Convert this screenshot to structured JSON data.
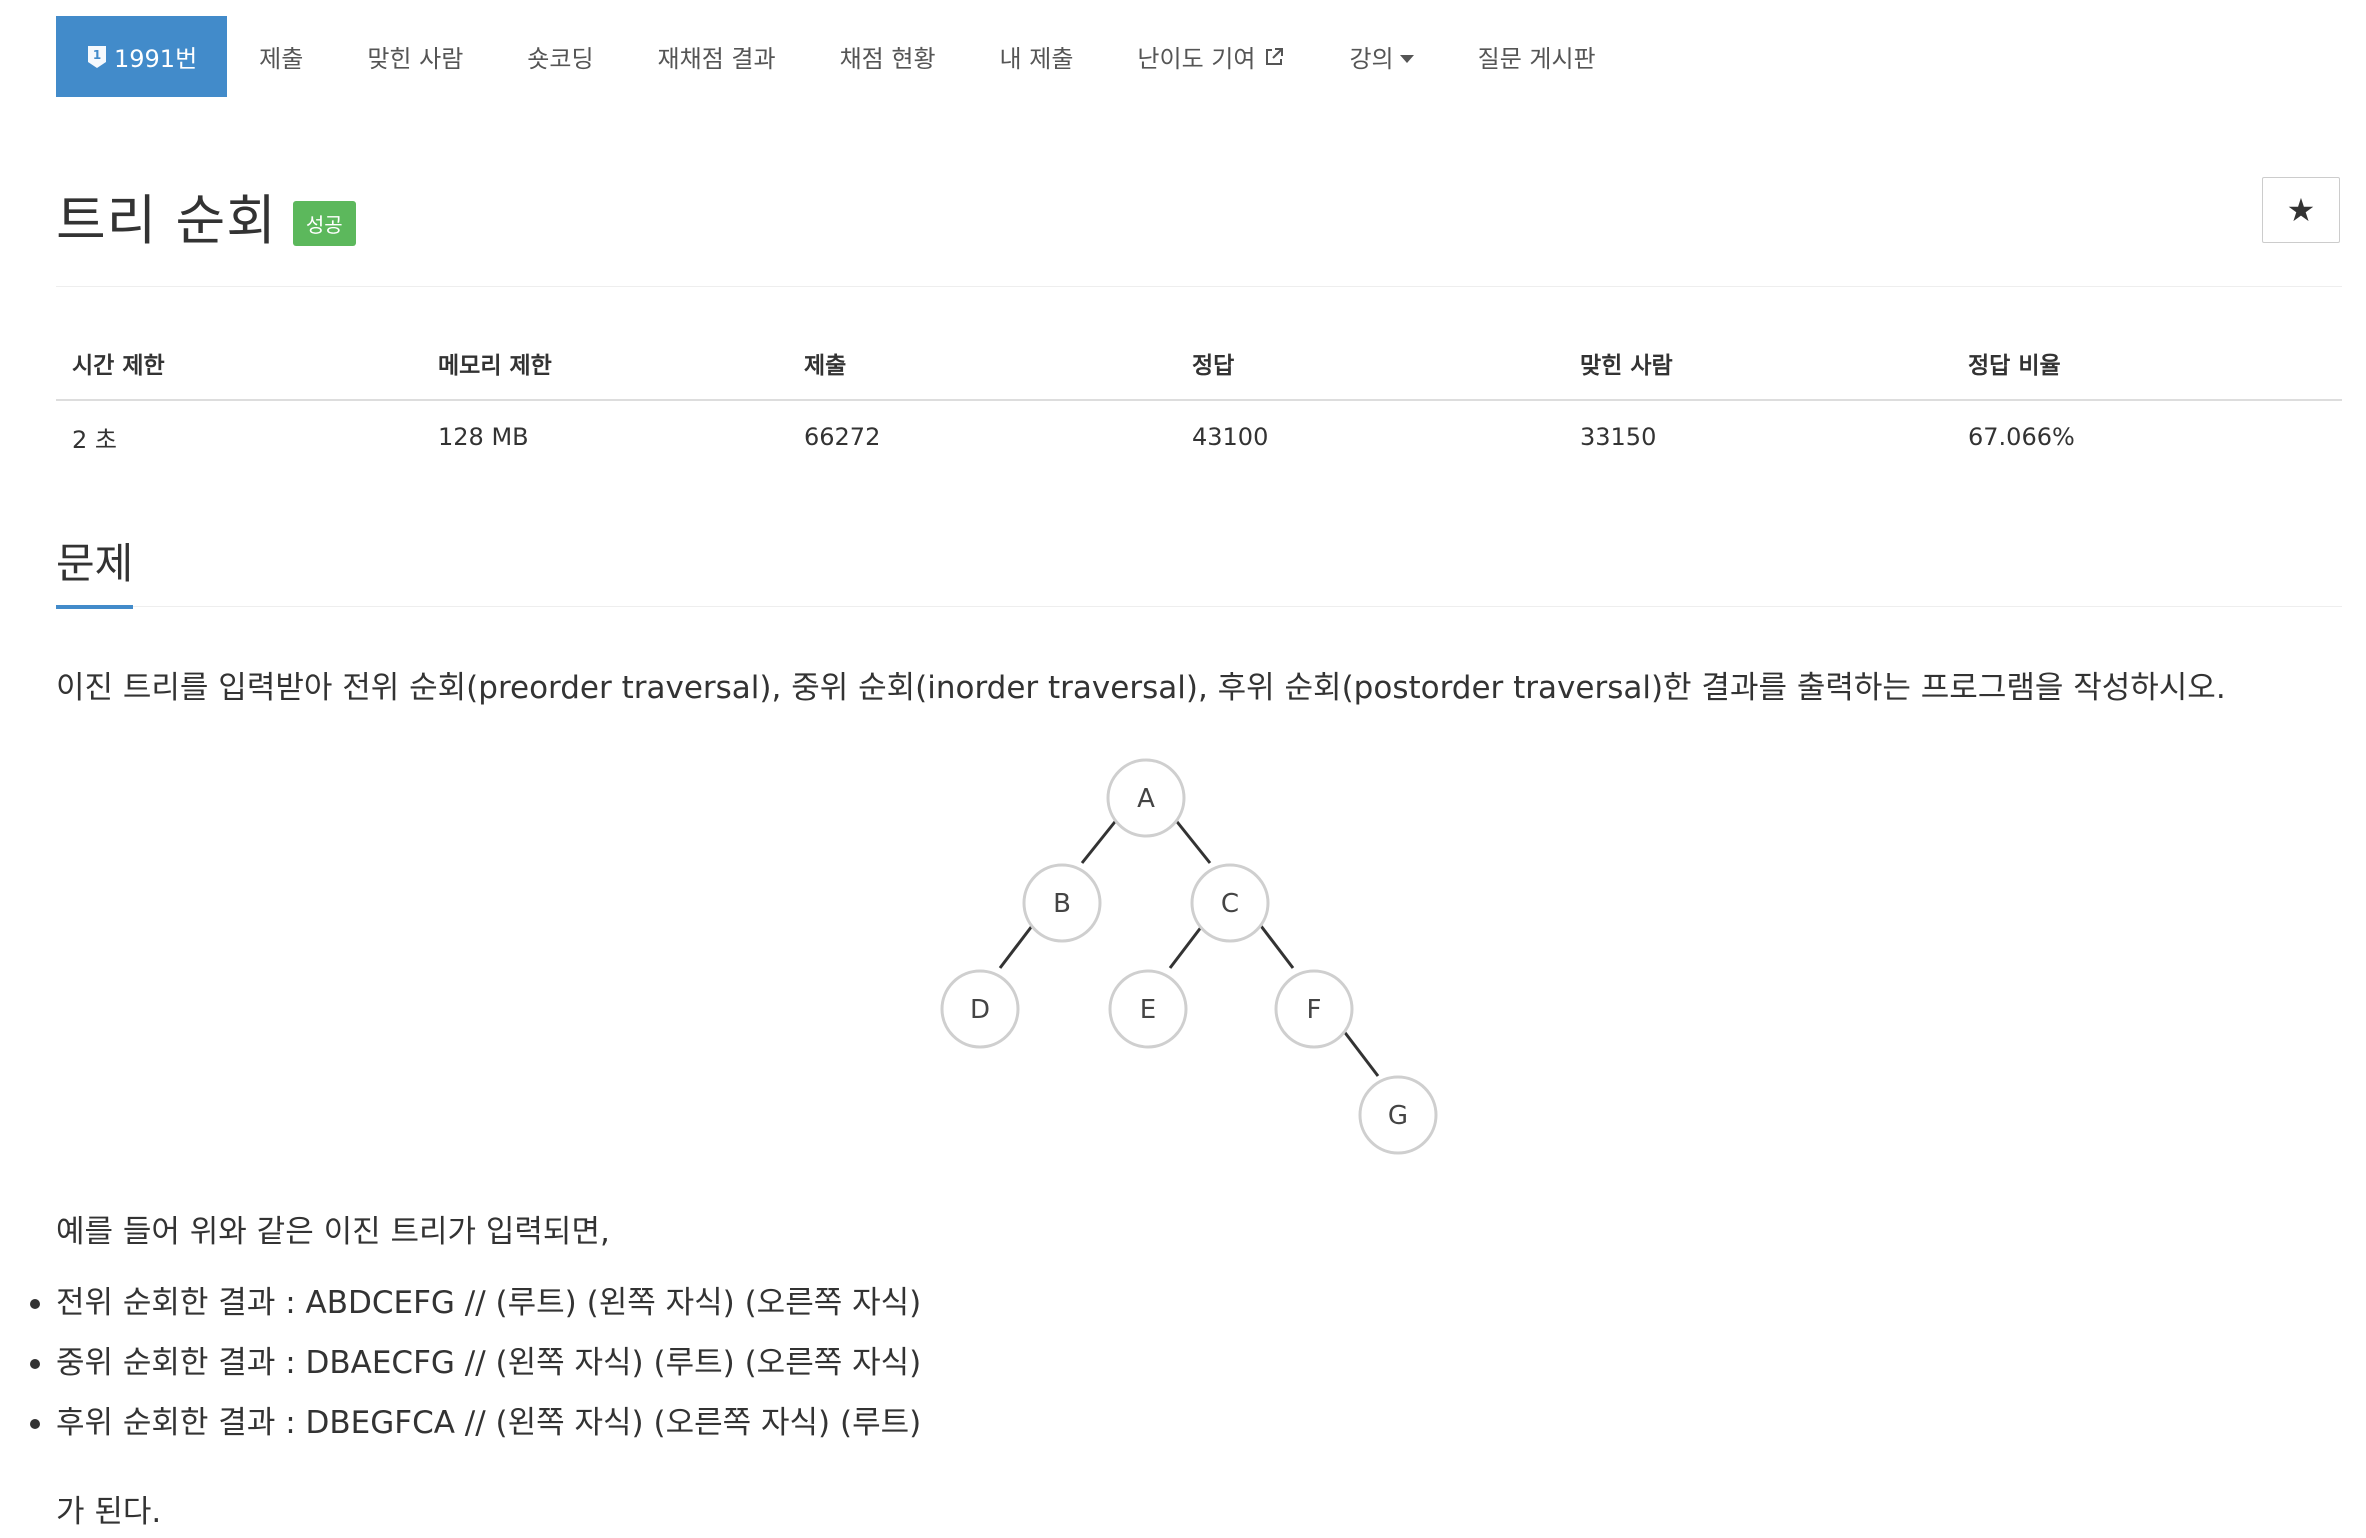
{
  "nav": {
    "problem_number": "1991번",
    "problem_badge_icon": "level-badge-icon",
    "items": [
      {
        "label": "제출"
      },
      {
        "label": "맞힌 사람"
      },
      {
        "label": "숏코딩"
      },
      {
        "label": "재채점 결과"
      },
      {
        "label": "채점 현황"
      },
      {
        "label": "내 제출"
      },
      {
        "label": "난이도 기여",
        "icon": "external-link-icon"
      },
      {
        "label": "강의",
        "icon": "caret-down-icon"
      },
      {
        "label": "질문 게시판"
      }
    ],
    "active_color": "#428bca"
  },
  "problem": {
    "title": "트리 순회",
    "status_badge": "성공",
    "status_color": "#5cb85c",
    "star_label": "★"
  },
  "info_table": {
    "headers": [
      "시간 제한",
      "메모리 제한",
      "제출",
      "정답",
      "맞힌 사람",
      "정답 비율"
    ],
    "values": [
      "2 초",
      "128 MB",
      "66272",
      "43100",
      "33150",
      "67.066%"
    ]
  },
  "section": {
    "title": "문제",
    "description": "이진 트리를 입력받아 전위 순회(preorder traversal), 중위 순회(inorder traversal), 후위 순회(postorder traversal)한 결과를 출력하는 프로그램을 작성하시오.",
    "tree": {
      "nodes": [
        "A",
        "B",
        "C",
        "D",
        "E",
        "F",
        "G"
      ]
    },
    "example_intro": "예를 들어 위와 같은 이진 트리가 입력되면,",
    "traversals": [
      "전위 순회한 결과 : ABDCEFG // (루트) (왼쪽 자식) (오른쪽 자식)",
      "중위 순회한 결과 : DBAECFG // (왼쪽 자식) (루트) (오른쪽 자식)",
      "후위 순회한 결과 : DBEGFCA // (왼쪽 자식) (오른쪽 자식) (루트)"
    ],
    "result_text": "가 된다."
  }
}
